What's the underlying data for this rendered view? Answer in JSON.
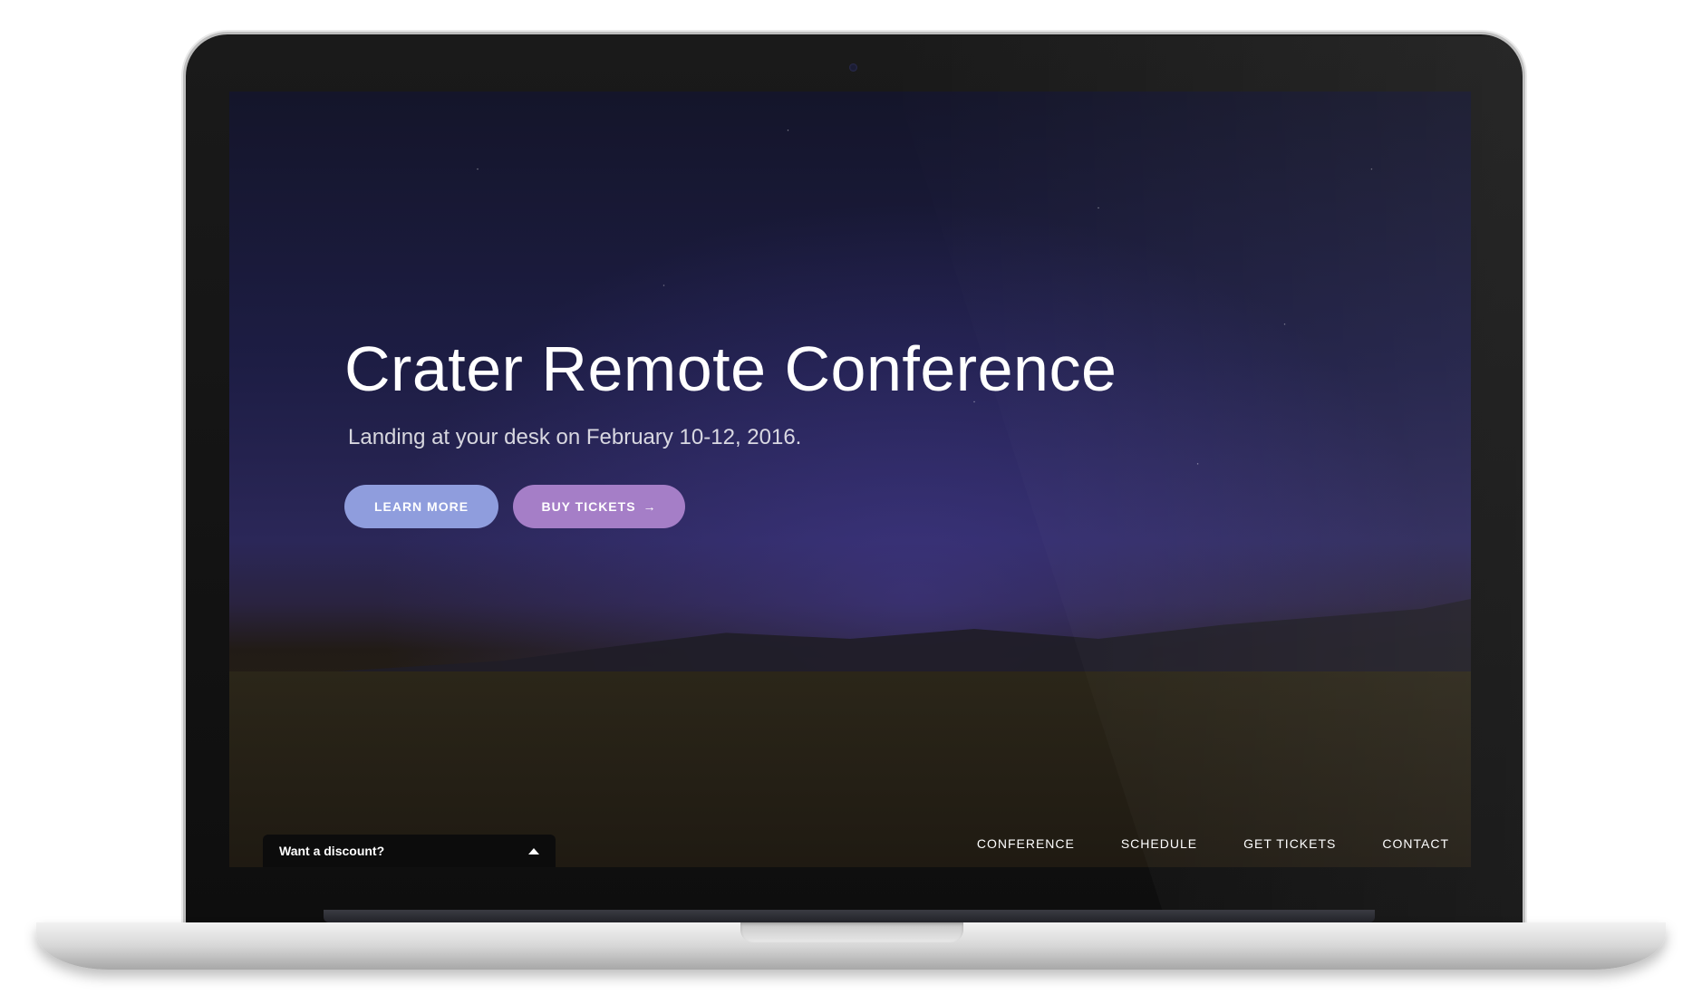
{
  "hero": {
    "title": "Crater Remote Conference",
    "subtitle": "Landing at your desk on February 10-12, 2016."
  },
  "buttons": {
    "learn_more": "LEARN MORE",
    "buy_tickets": "BUY TICKETS",
    "buy_tickets_icon": "arrow-right-icon"
  },
  "discount": {
    "label": "Want a discount?",
    "icon": "caret-up-icon"
  },
  "nav": {
    "items": [
      {
        "label": "CONFERENCE"
      },
      {
        "label": "SCHEDULE"
      },
      {
        "label": "GET TICKETS"
      },
      {
        "label": "CONTACT"
      }
    ]
  },
  "colors": {
    "learn_more": "#8f9ddd",
    "buy_tickets": "#a57ec7"
  }
}
